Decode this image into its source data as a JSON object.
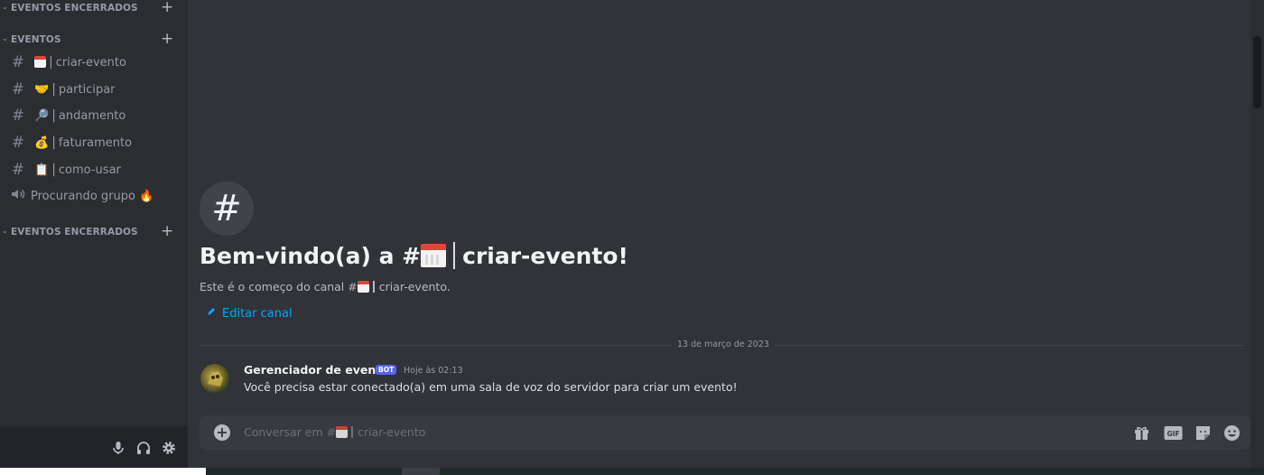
{
  "sidebar": {
    "categories": [
      {
        "label": "EVENTOS ENCERRADOS",
        "chevron": "⌄",
        "add": "+"
      },
      {
        "label": "EVENTOS",
        "chevron": "⌄",
        "add": "+"
      },
      {
        "label": "EVENTOS ENCERRADOS",
        "chevron": "⌄",
        "add": "+"
      }
    ],
    "channels": [
      {
        "type": "text",
        "icon": "#",
        "emoji": "calendar-icon",
        "separator": "|",
        "name": "criar-evento"
      },
      {
        "type": "text",
        "icon": "#",
        "emoji": "🤝",
        "separator": "|",
        "name": "participar"
      },
      {
        "type": "text",
        "icon": "#",
        "emoji": "🔎",
        "separator": "|",
        "name": "andamento"
      },
      {
        "type": "text",
        "icon": "#",
        "emoji": "💰",
        "separator": "|",
        "name": "faturamento"
      },
      {
        "type": "text",
        "icon": "#",
        "emoji": "📋",
        "separator": "|",
        "name": "como-usar"
      },
      {
        "type": "voice",
        "icon": "speaker-icon",
        "name": "Procurando grupo 🔥"
      }
    ],
    "user_controls": [
      "microphone-icon",
      "headphones-icon",
      "settings-icon"
    ]
  },
  "main": {
    "hash_symbol": "#",
    "welcome_prefix": "Bem-vindo(a) a #",
    "welcome_channel": "criar-evento!",
    "subtitle_prefix": "Este é o começo do canal #",
    "subtitle_channel": "criar-evento.",
    "edit_channel_label": "Editar canal",
    "date_divider": "13 de março de 2023",
    "message": {
      "author": "Gerenciador de eventos",
      "bot_tag": "BOT",
      "timestamp": "Hoje às 02:13",
      "text": "Você precisa estar conectado(a) em uma sala de voz do servidor para criar um evento!"
    }
  },
  "composer": {
    "add_symbol": "+",
    "placeholder_prefix": "Conversar em #",
    "placeholder_channel": "criar-evento",
    "icons": [
      "gift-icon",
      "gif-icon",
      "sticker-icon",
      "emoji-icon"
    ],
    "gif_label": "GIF"
  },
  "colors": {
    "accent": "#5865f2",
    "link": "#00a8fc",
    "background": "#313338",
    "sidebar": "#2b2d31"
  }
}
